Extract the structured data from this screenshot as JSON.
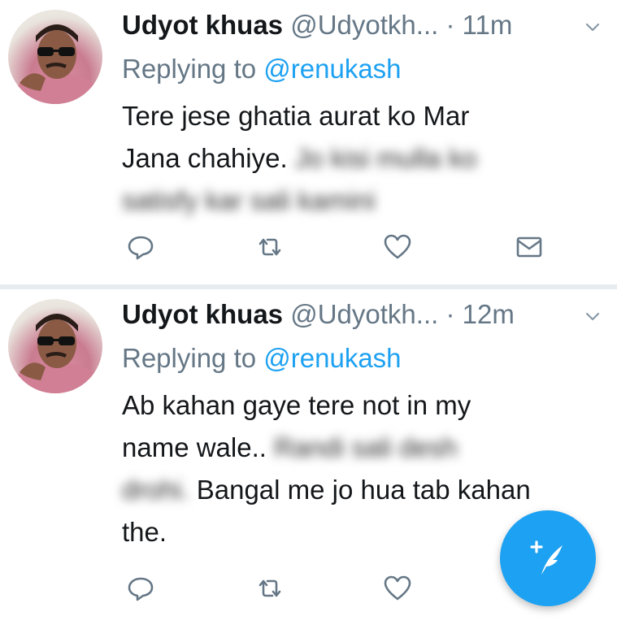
{
  "tweets": [
    {
      "name": "Udyot khuas",
      "handle": "@Udyotkh...",
      "dot": "·",
      "time": "11m",
      "reply_prefix": "Replying to ",
      "reply_mention": "@renukash",
      "text_line1": "Tere jese ghatia aurat ko Mar",
      "text_line2_clear": "Jana chahiye.",
      "text_line2_blur": "Jo kisi mulla ko",
      "text_line3_blur": "satisfy kar sali kamini"
    },
    {
      "name": "Udyot khuas",
      "handle": "@Udyotkh...",
      "dot": "·",
      "time": "12m",
      "reply_prefix": "Replying to ",
      "reply_mention": "@renukash",
      "text_line1": "Ab kahan gaye tere not in my",
      "text_line2_clear": "name wale..",
      "text_line2_blur": "Randi sali desh",
      "text_line3_blur": "drohi.",
      "text_line3_clear": " Bangal me jo hua tab kahan",
      "text_line4": "the."
    }
  ],
  "icons": {
    "reply": "reply-icon",
    "retweet": "retweet-icon",
    "like": "heart-icon",
    "dm": "envelope-icon",
    "menu": "chevron-down-icon",
    "compose": "compose-tweet-icon"
  },
  "colors": {
    "accent": "#1da1f2",
    "secondary_text": "#657786",
    "primary_text": "#14171a",
    "divider": "#e6ecf0"
  }
}
